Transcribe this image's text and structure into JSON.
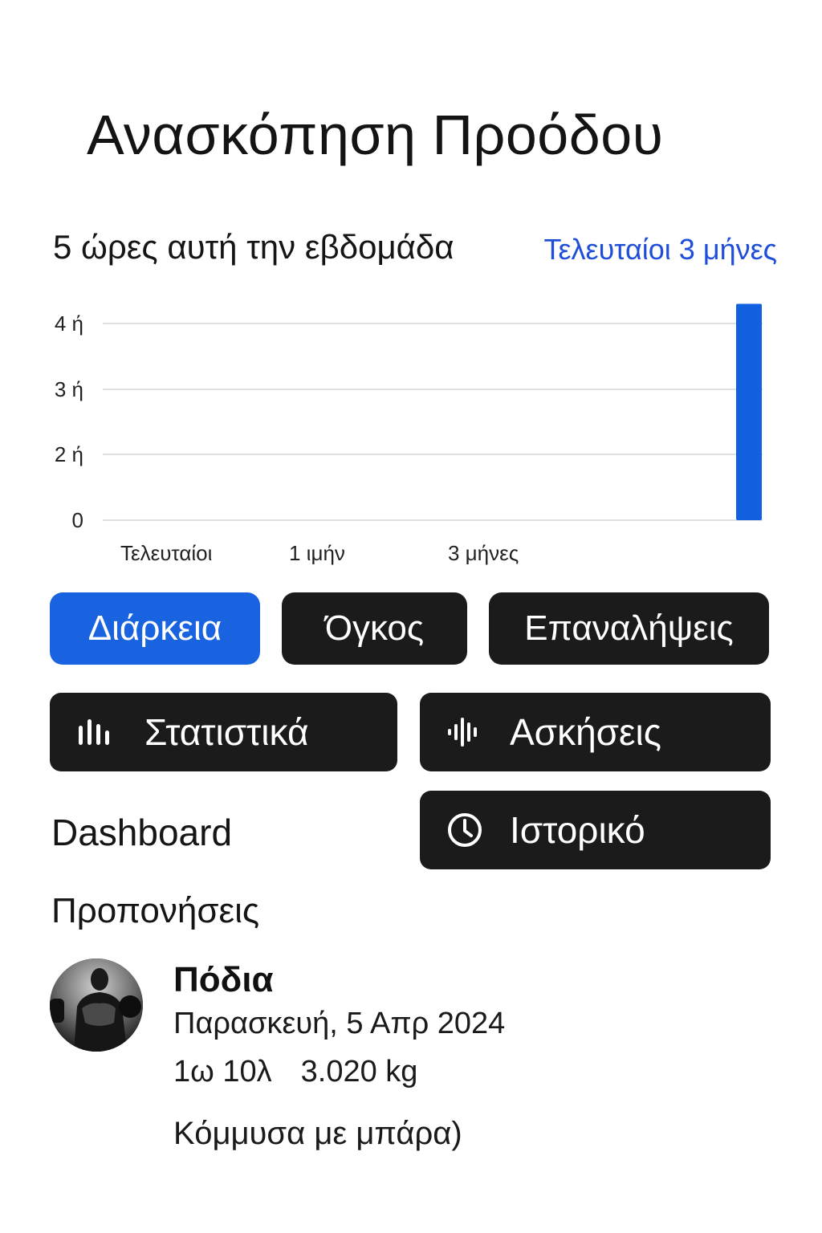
{
  "header": {
    "title": "Ανασκόπηση Προόδου"
  },
  "summary": {
    "text": "5 ώρες αυτή την εβδομάδα",
    "range_link": "Τελευταίοι 3 μήνες"
  },
  "chart_data": {
    "type": "bar",
    "y_ticks": [
      "0",
      "2 ή",
      "3 ή",
      "4 ή"
    ],
    "x_labels": [
      "Τελευταίοι",
      "1 ιμήν",
      "3 μήνες"
    ],
    "values": [
      4.4
    ],
    "ylim": [
      0,
      4.5
    ],
    "grid": true,
    "bar_color": "#1160e0"
  },
  "metric_tabs": [
    {
      "label": "Διάρκεια",
      "active": true
    },
    {
      "label": "Όγκος",
      "active": false
    },
    {
      "label": "Επαναλήψεις",
      "active": false
    }
  ],
  "nav": {
    "stats": {
      "label": "Στατιστικά",
      "icon": "bar-chart-icon"
    },
    "exercises": {
      "label": "Ασκήσεις",
      "icon": "waveform-icon"
    },
    "history": {
      "label": "Ιστορικό",
      "icon": "clock-icon"
    }
  },
  "dashboard_label": "Dashboard",
  "workouts": {
    "title": "Προπονήσεις",
    "items": [
      {
        "name": "Πόδια",
        "date": "Παρασκευή, 5 Απρ 2024",
        "duration": "1ω 10λ",
        "volume": "3.020 kg",
        "exercise": "Κόμμυσα με μπάρα)"
      }
    ]
  },
  "colors": {
    "accent": "#1a63e0",
    "button_dark": "#1b1b1b",
    "link": "#1f4fd8"
  }
}
